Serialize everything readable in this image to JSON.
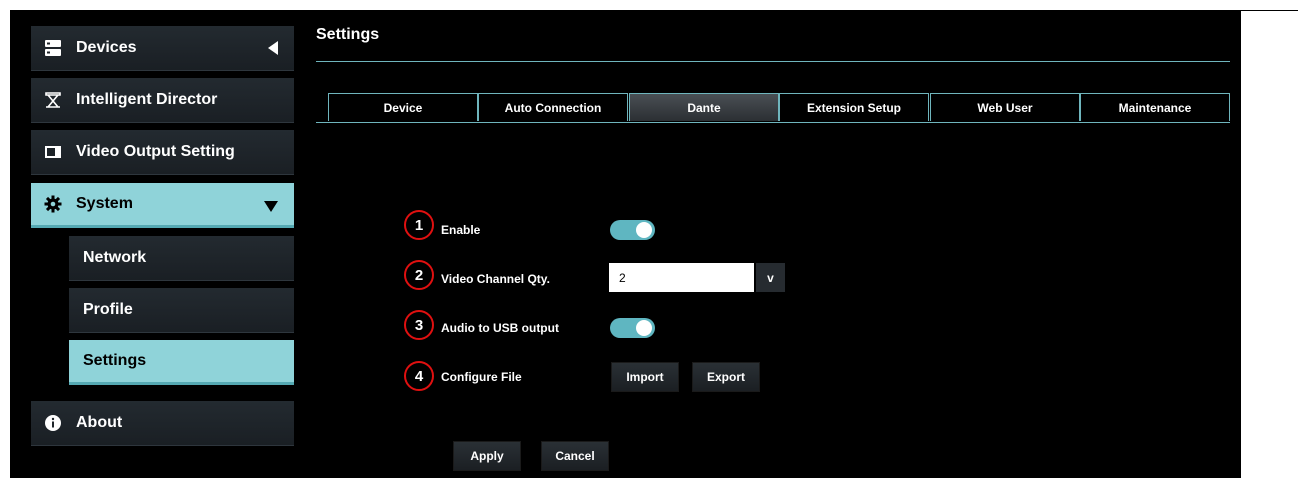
{
  "sidebar": {
    "devices": "Devices",
    "intelligent_director": "Intelligent Director",
    "video_output": "Video Output Setting",
    "system": "System",
    "network": "Network",
    "profile": "Profile",
    "settings": "Settings",
    "about": "About"
  },
  "header": {
    "title": "Settings"
  },
  "tabs": [
    {
      "label": "Device"
    },
    {
      "label": "Auto Connection"
    },
    {
      "label": "Dante"
    },
    {
      "label": "Extension Setup"
    },
    {
      "label": "Web User"
    },
    {
      "label": "Maintenance"
    }
  ],
  "active_tab": "Dante",
  "form": {
    "enable": {
      "num": "1",
      "label": "Enable",
      "on": true
    },
    "video_channel": {
      "num": "2",
      "label": "Video Channel Qty.",
      "value": "2",
      "dropdown": "v"
    },
    "audio_usb": {
      "num": "3",
      "label": "Audio to USB output",
      "on": true
    },
    "configure": {
      "num": "4",
      "label": "Configure File",
      "import": "Import",
      "export": "Export"
    }
  },
  "actions": {
    "apply": "Apply",
    "cancel": "Cancel"
  },
  "colors": {
    "accent": "#8fd3d9",
    "toggle": "#5fb6c1",
    "marker": "#e01010"
  }
}
